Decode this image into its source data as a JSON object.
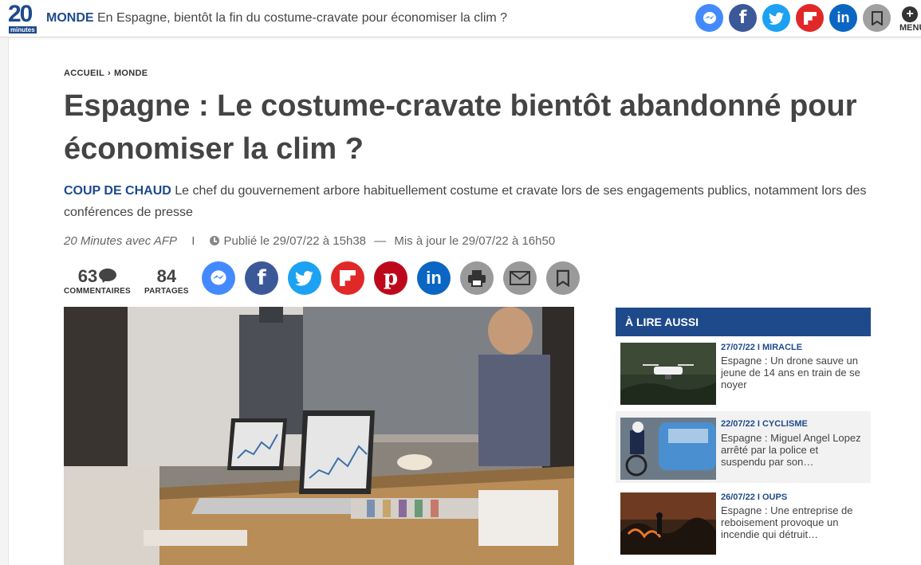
{
  "topbar": {
    "logo": {
      "number": "20",
      "word": "minutes"
    },
    "section": "MONDE",
    "headline": "En Espagne, bientôt la fin du costume-cravate pour économiser la clim ?",
    "share": [
      {
        "icon": "messenger-icon",
        "color": "#448aff",
        "glyph": "⚡"
      },
      {
        "icon": "facebook-icon",
        "color": "#3b5998",
        "glyph": "f"
      },
      {
        "icon": "twitter-icon",
        "color": "#1da1f2",
        "glyph": "🐦"
      },
      {
        "icon": "flipboard-icon",
        "color": "#e12828",
        "glyph": "F"
      },
      {
        "icon": "linkedin-icon",
        "color": "#0a66c2",
        "glyph": "in"
      },
      {
        "icon": "bookmark-icon",
        "color": "#a0a0a0",
        "glyph": "▯"
      }
    ],
    "menu_label": "MENU",
    "menu_plus": "+"
  },
  "breadcrumb": {
    "home": "ACCUEIL",
    "separator": "›",
    "section": "MONDE"
  },
  "article": {
    "title": "Espagne : Le costume-cravate bientôt abandonné pour économiser la clim ?",
    "kicker": "COUP DE CHAUD",
    "lead": "Le chef du gouvernement arbore habituellement costume et cravate lors de ses engagements publics, notamment lors des conférences de presse",
    "author": "20 Minutes avec AFP",
    "pipe": "I",
    "published": "Publié le 29/07/22 à 15h38",
    "dash": "—",
    "updated": "Mis à jour le 29/07/22 à 16h50"
  },
  "counters": {
    "comments": {
      "value": "63",
      "label": "COMMENTAIRES"
    },
    "shares": {
      "value": "84",
      "label": "PARTAGES"
    }
  },
  "share_buttons": [
    {
      "icon": "messenger-icon",
      "color": "#448aff"
    },
    {
      "icon": "facebook-icon",
      "color": "#3b5998"
    },
    {
      "icon": "twitter-icon",
      "color": "#1da1f2"
    },
    {
      "icon": "flipboard-icon",
      "color": "#e12828"
    },
    {
      "icon": "pinterest-icon",
      "color": "#bd081c"
    },
    {
      "icon": "linkedin-icon",
      "color": "#0a66c2"
    },
    {
      "icon": "print-icon",
      "color": "#9a9a9a"
    },
    {
      "icon": "email-icon",
      "color": "#9a9a9a"
    },
    {
      "icon": "bookmark-icon",
      "color": "#9a9a9a"
    }
  ],
  "aside": {
    "heading": "À LIRE AUSSI",
    "items": [
      {
        "kicker": "27/07/22 I MIRACLE",
        "title": "Espagne : Un drone sauve un jeune de 14 ans en train de se noyer"
      },
      {
        "kicker": "22/07/22 I CYCLISME",
        "title": "Espagne : Miguel Angel Lopez arrêté par la police et suspendu par son…"
      },
      {
        "kicker": "26/07/22 I OUPS",
        "title": "Espagne : Une entreprise de reboisement provoque un incendie qui détruit…"
      }
    ]
  }
}
